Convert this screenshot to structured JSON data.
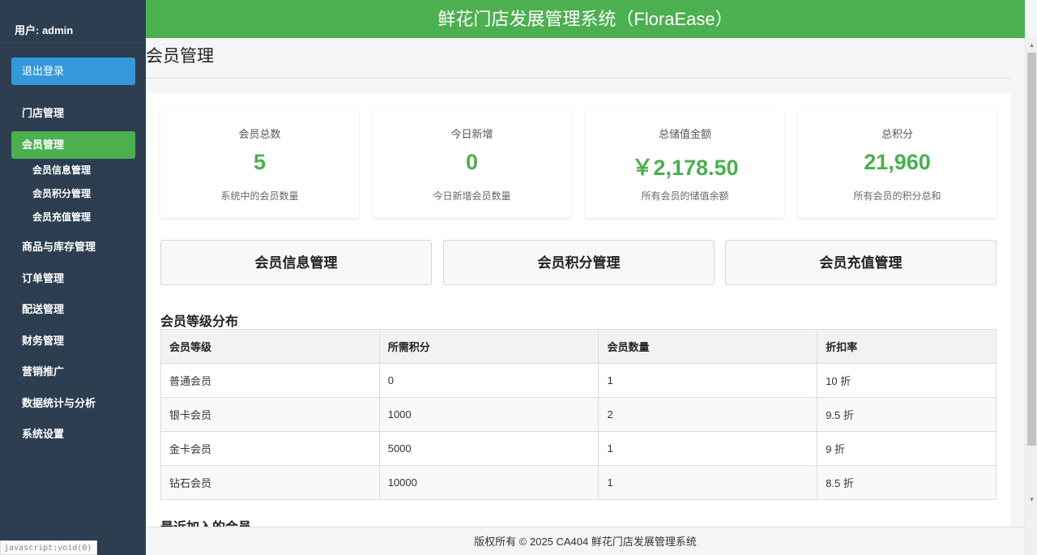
{
  "sidebar": {
    "user_label": "用户: admin",
    "logout": "退出登录",
    "items": [
      {
        "label": "门店管理"
      },
      {
        "label": "会员管理"
      },
      {
        "label": "商品与库存管理"
      },
      {
        "label": "订单管理"
      },
      {
        "label": "配送管理"
      },
      {
        "label": "财务管理"
      },
      {
        "label": "营销推广"
      },
      {
        "label": "数据统计与分析"
      },
      {
        "label": "系统设置"
      }
    ],
    "sub_items": [
      {
        "label": "会员信息管理"
      },
      {
        "label": "会员积分管理"
      },
      {
        "label": "会员充值管理"
      }
    ]
  },
  "header": {
    "title": "鲜花门店发展管理系统（FloraEase）"
  },
  "page": {
    "title": "会员管理"
  },
  "stats": [
    {
      "label": "会员总数",
      "value": "5",
      "desc": "系统中的会员数量"
    },
    {
      "label": "今日新增",
      "value": "0",
      "desc": "今日新增会员数量"
    },
    {
      "label": "总储值金额",
      "value": "￥2,178.50",
      "desc": "所有会员的储值余额"
    },
    {
      "label": "总积分",
      "value": "21,960",
      "desc": "所有会员的积分总和"
    }
  ],
  "actions": [
    {
      "label": "会员信息管理"
    },
    {
      "label": "会员积分管理"
    },
    {
      "label": "会员充值管理"
    }
  ],
  "levels": {
    "title": "会员等级分布",
    "headers": [
      "会员等级",
      "所需积分",
      "会员数量",
      "折扣率"
    ],
    "rows": [
      [
        "普通会员",
        "0",
        "1",
        "10 折"
      ],
      [
        "银卡会员",
        "1000",
        "2",
        "9.5 折"
      ],
      [
        "金卡会员",
        "5000",
        "1",
        "9 折"
      ],
      [
        "钻石会员",
        "10000",
        "1",
        "8.5 折"
      ]
    ]
  },
  "recent": {
    "title": "最近加入的会员"
  },
  "footer": {
    "text": "版权所有 © 2025 CA404 鲜花门店发展管理系统"
  },
  "statusbar": {
    "text": "javascript:void(0)"
  },
  "colors": {
    "sidebar_bg": "#2c3e50",
    "accent_green": "#4caf50",
    "logout_blue": "#3498db"
  }
}
